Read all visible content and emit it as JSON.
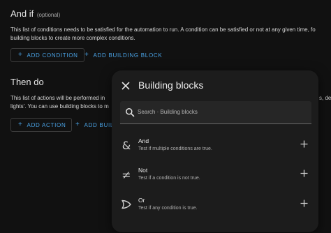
{
  "and_if": {
    "title": "And if",
    "optional": "(optional)",
    "desc_line1": "This list of conditions needs to be satisfied for the automation to run. A condition can be satisfied or not at any given time, fo",
    "desc_line2": "building blocks to create more complex conditions.",
    "add_condition_label": "ADD CONDITION",
    "add_building_block_label": "ADD BUILDING BLOCK"
  },
  "then_do": {
    "title": "Then do",
    "desc_line1": "This list of actions will be performed in",
    "desc_line1_right": "s, de",
    "desc_line2": "lights'. You can use building blocks to m",
    "add_action_label": "ADD ACTION",
    "add_building_block_label": "ADD BUILI"
  },
  "dialog": {
    "title": "Building blocks",
    "search_placeholder": "Search · Building blocks",
    "items": [
      {
        "title": "And",
        "subtitle": "Test if multiple conditions are true.",
        "icon": "ampersand-icon"
      },
      {
        "title": "Not",
        "subtitle": "Test if a condition is not true.",
        "icon": "not-equal-icon"
      },
      {
        "title": "Or",
        "subtitle": "Test if any condition is true.",
        "icon": "or-gate-icon"
      }
    ]
  },
  "colors": {
    "background": "#111111",
    "dialog": "#1c1c1c",
    "accent": "#4aa3e6"
  }
}
